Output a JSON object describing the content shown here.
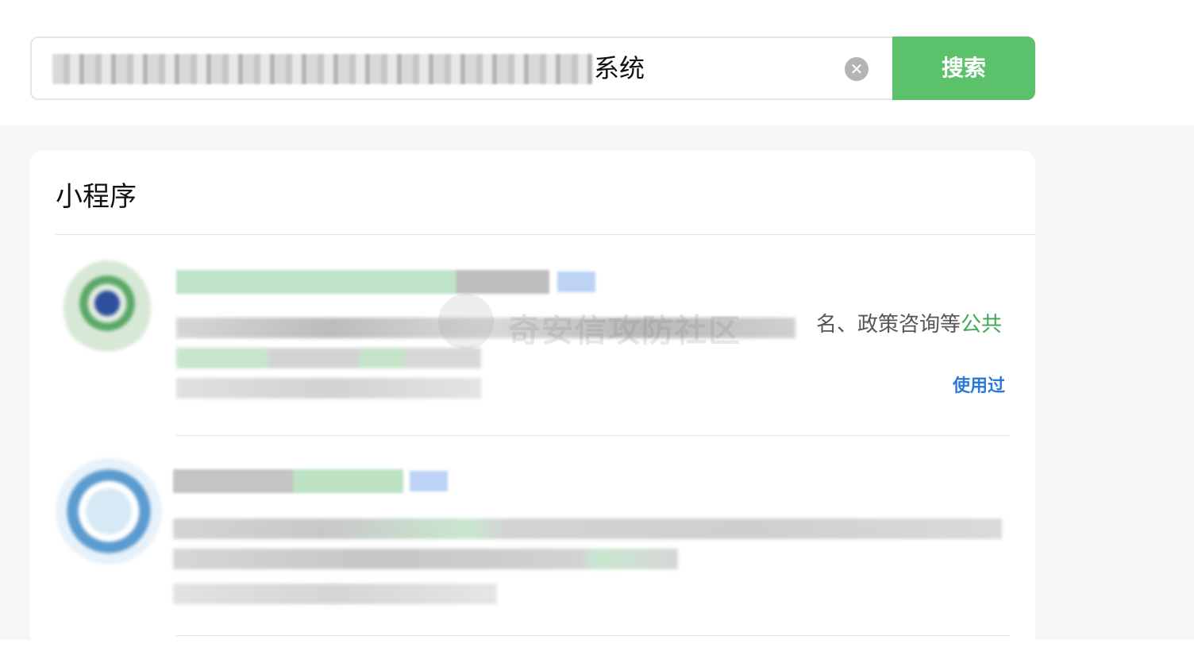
{
  "search": {
    "query_visible_suffix": "系统",
    "clear_icon": "✕",
    "button_label": "搜索"
  },
  "results": {
    "section_title": "小程序",
    "items": [
      {
        "desc_visible_prefix": "名、政策咨询等",
        "desc_visible_highlight": "公共",
        "badge": "使用过"
      },
      {}
    ]
  },
  "watermark": {
    "text": "奇安信攻防社区"
  },
  "colors": {
    "accent_green": "#5cc16b",
    "highlight_green": "#3aab50",
    "link_blue": "#2b7ad8",
    "page_grey": "#f6f6f6"
  }
}
